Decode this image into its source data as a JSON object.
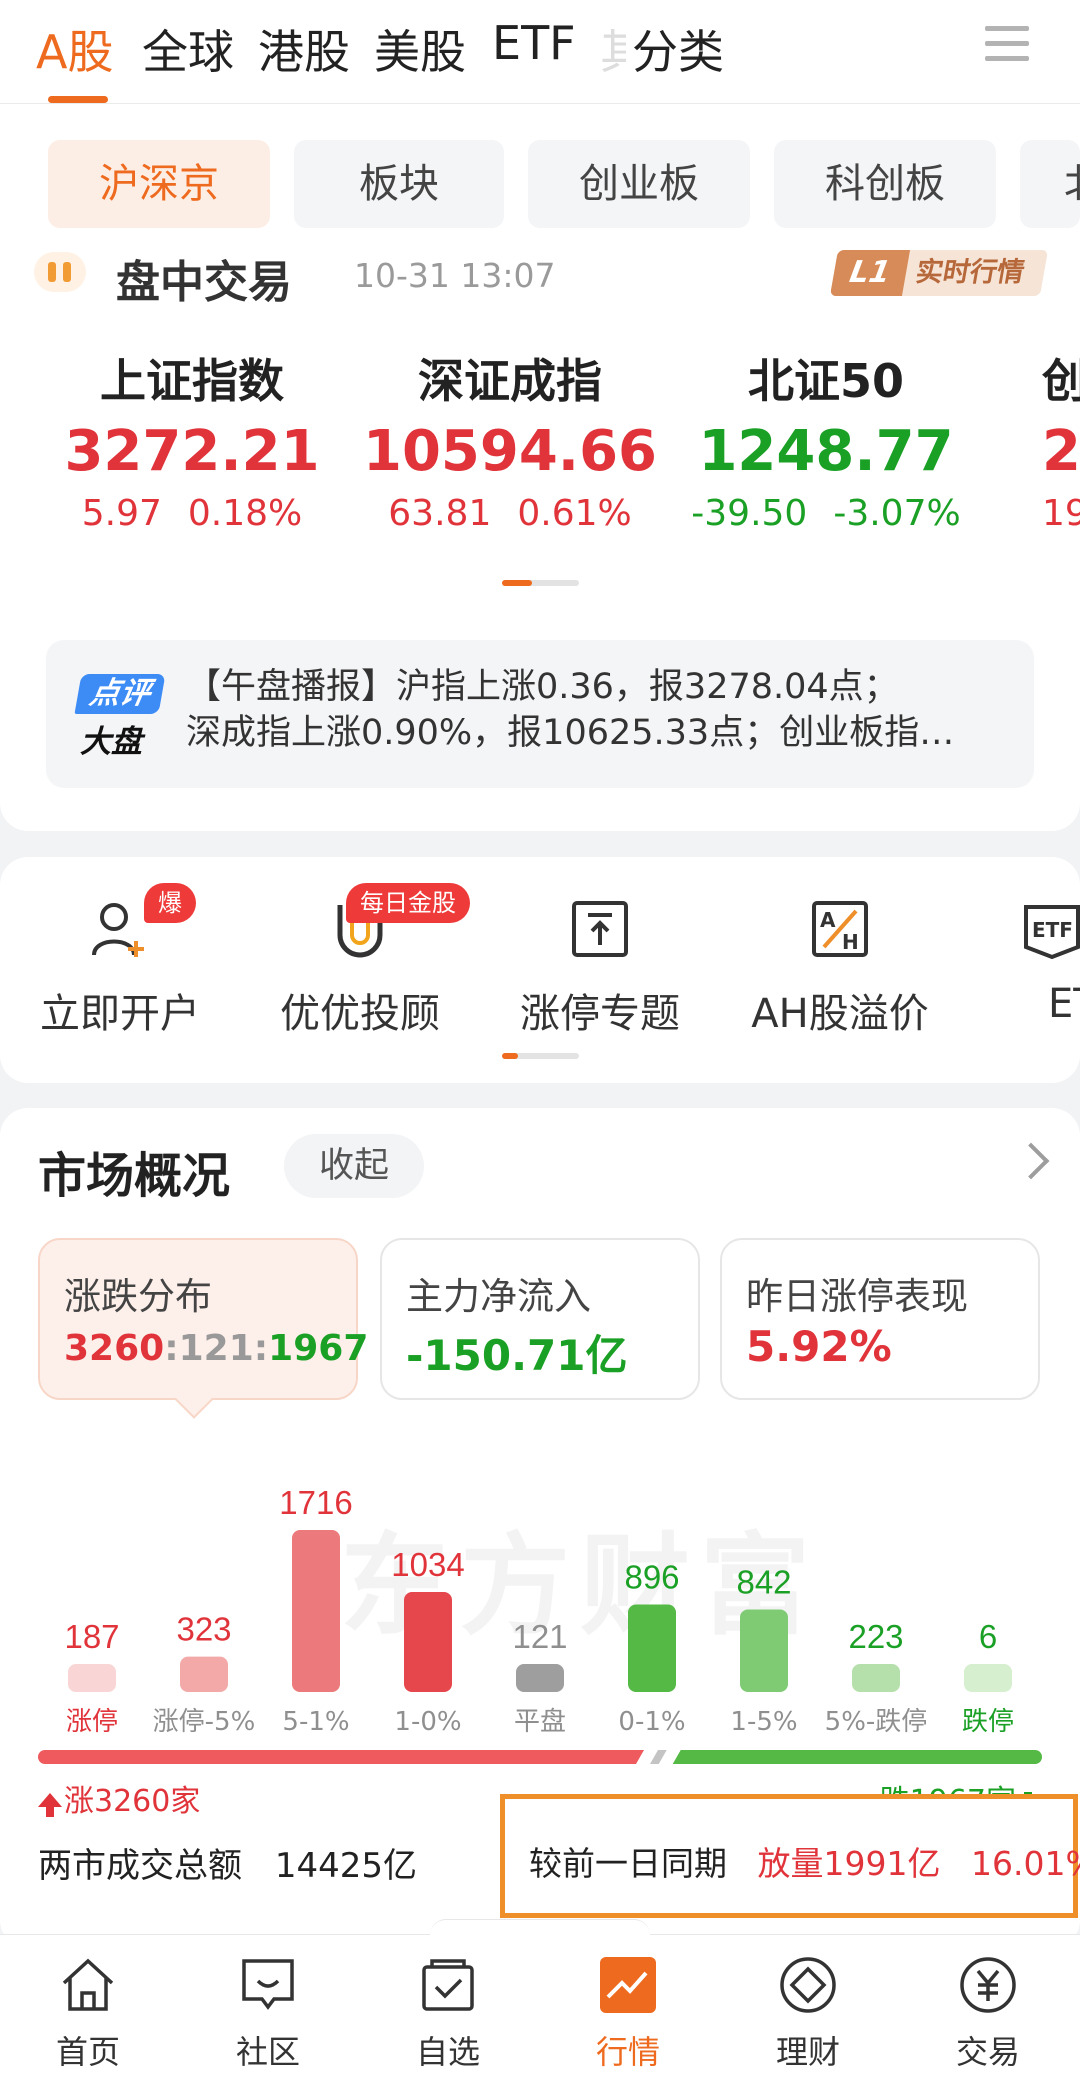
{
  "top_tabs": [
    "A股",
    "全球",
    "港股",
    "美股",
    "ETF",
    "其",
    "分类"
  ],
  "sub_tabs": [
    "沪深京",
    "板块",
    "创业板",
    "科创板",
    "北"
  ],
  "market_status": {
    "title": "盘中交易",
    "time": "10-31 13:07",
    "badge_tag": "L1",
    "badge_label": "实时行情"
  },
  "indices": [
    {
      "name": "上证指数",
      "value": "3272.21",
      "change": "5.97",
      "pct": "0.18%",
      "trend": "up"
    },
    {
      "name": "深证成指",
      "value": "10594.66",
      "change": "63.81",
      "pct": "0.61%",
      "trend": "up"
    },
    {
      "name": "北证50",
      "value": "1248.77",
      "change": "-39.50",
      "pct": "-3.07%",
      "trend": "down"
    },
    {
      "name": "创",
      "value": "2",
      "change": "19.",
      "pct": "",
      "trend": "up"
    }
  ],
  "news": {
    "logo_top": "点评",
    "logo_bottom": "大盘",
    "line1": "【午盘播报】沪指上涨0.36，报3278.04点；",
    "line2": "深成指上涨0.90%，报10625.33点；创业板指…"
  },
  "entries": [
    {
      "label": "立即开户",
      "badge": "爆",
      "icon": "user-plus-icon"
    },
    {
      "label": "优优投顾",
      "badge": "每日金股",
      "icon": "magnet-icon"
    },
    {
      "label": "涨停专题",
      "badge": "",
      "icon": "limit-up-icon"
    },
    {
      "label": "AH股溢价",
      "badge": "",
      "icon": "ah-premium-icon"
    },
    {
      "label": "ET",
      "badge": "",
      "icon": "etf-icon"
    }
  ],
  "market": {
    "title": "市场概况",
    "collapse_label": "收起",
    "cards": [
      {
        "title": "涨跌分布",
        "up": "3260",
        "flat": "121",
        "down": "1967",
        "sep": ":"
      },
      {
        "title": "主力净流入",
        "value": "-150.71亿"
      },
      {
        "title": "昨日涨停表现",
        "value": "5.92%"
      }
    ],
    "watermark": "东方财富",
    "up_label": "涨3260家",
    "down_label": "跌1967家",
    "turnover_label": "两市成交总额",
    "turnover_value": "14425亿",
    "compare_label": "较前一日同期",
    "compare_volume": "放量1991亿",
    "compare_pct": "16.01%"
  },
  "chart_data": {
    "type": "bar",
    "categories": [
      "涨停",
      "涨停-5%",
      "5-1%",
      "1-0%",
      "平盘",
      "0-1%",
      "1-5%",
      "5%-跌停",
      "跌停"
    ],
    "values": [
      187,
      323,
      1716,
      1034,
      121,
      896,
      842,
      223,
      6
    ],
    "colors": [
      "#f9d5d5",
      "#f4a9a9",
      "#ec7a7c",
      "#e5474d",
      "#9e9e9e",
      "#55b946",
      "#7fcb74",
      "#b5e0ac",
      "#d5efcf"
    ],
    "label_colors": [
      "#e0333a",
      "#e0333a",
      "#e0333a",
      "#e0333a",
      "#8f8f8f",
      "#1ba026",
      "#1ba026",
      "#1ba026",
      "#1ba026"
    ],
    "ratio": {
      "up": 3260,
      "flat": 121,
      "down": 1967
    }
  },
  "bottom_nav": [
    {
      "label": "首页",
      "icon": "home-icon"
    },
    {
      "label": "社区",
      "icon": "community-icon"
    },
    {
      "label": "自选",
      "icon": "watchlist-icon"
    },
    {
      "label": "行情",
      "icon": "market-icon"
    },
    {
      "label": "理财",
      "icon": "wealth-icon"
    },
    {
      "label": "交易",
      "icon": "trade-icon"
    }
  ],
  "colors": {
    "accent": "#ee6a1e",
    "up": "#e0333a",
    "down": "#1ba026"
  }
}
